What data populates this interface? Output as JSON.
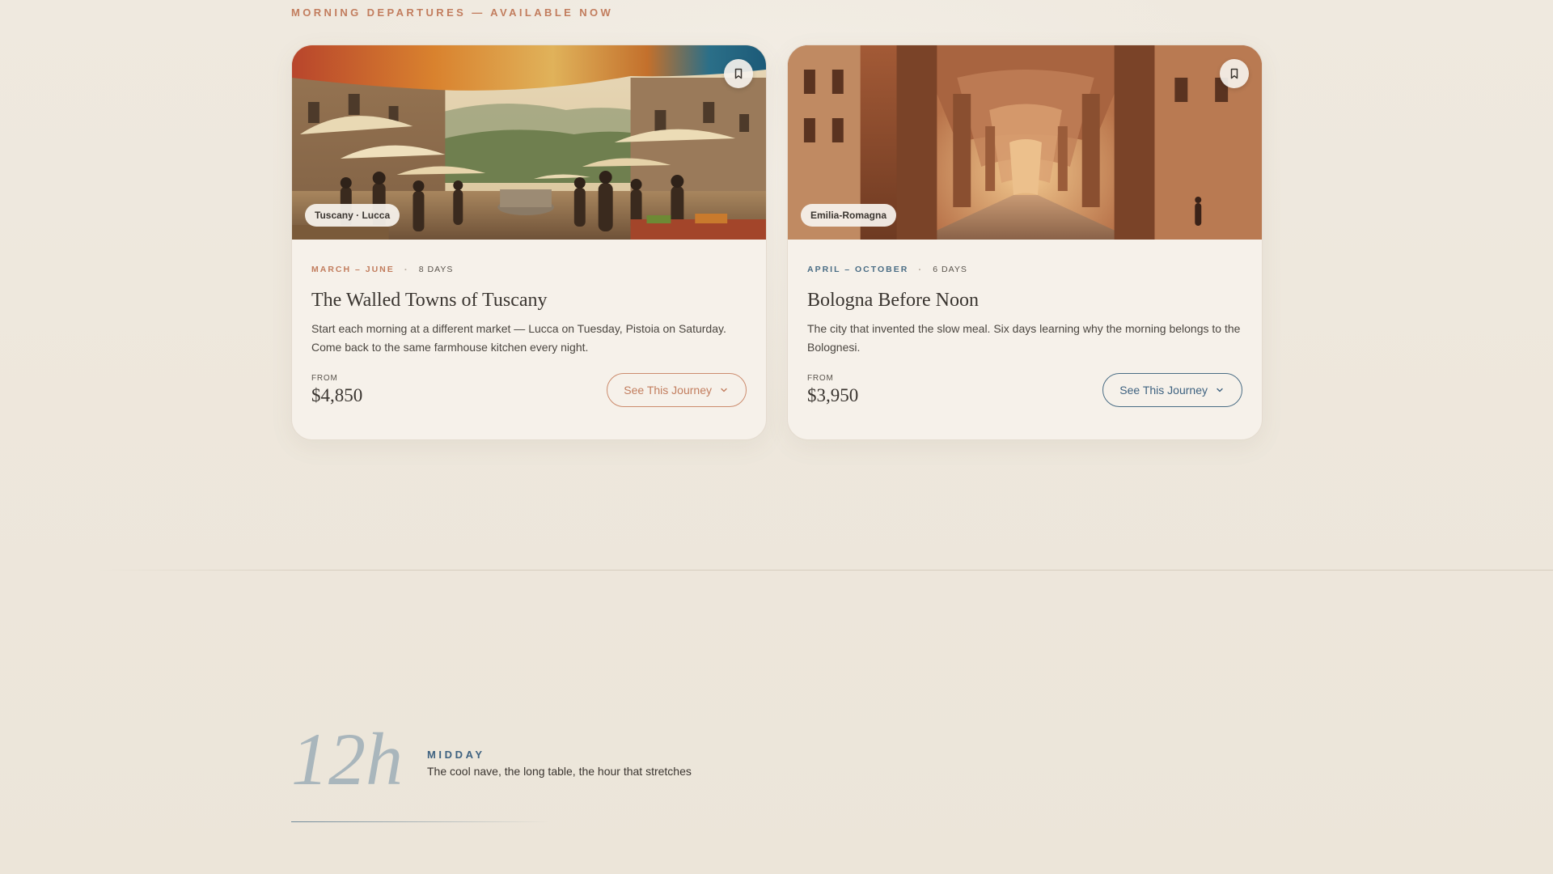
{
  "eyebrow": "MORNING DEPARTURES — AVAILABLE NOW",
  "cards": [
    {
      "region": "Tuscany · Lucca",
      "season": "MARCH – JUNE",
      "days": "8 DAYS",
      "title": "The Walled Towns of Tuscany",
      "description": "Start each morning at a different market — Lucca on Tuesday, Pistoia on Saturday. Come back to the same farmhouse kitchen every night.",
      "from_label": "FROM",
      "price": "$4,850",
      "cta": "See This Journey",
      "accent": "#c27d5e"
    },
    {
      "region": "Emilia-Romagna",
      "season": "APRIL – OCTOBER",
      "days": "6 DAYS",
      "title": "Bologna Before Noon",
      "description": "The city that invented the slow meal. Six days learning why the morning belongs to the Bolognesi.",
      "from_label": "FROM",
      "price": "$3,950",
      "cta": "See This Journey",
      "accent": "#3e6280"
    }
  ],
  "midday": {
    "hour": "12h",
    "label": "MIDDAY",
    "description": "The cool nave, the long table, the hour that stretches"
  },
  "icons": {
    "bookmark": "bookmark-icon",
    "chevron": "chevron-down-icon"
  }
}
